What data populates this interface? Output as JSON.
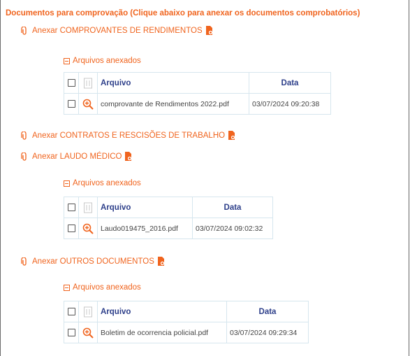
{
  "page_title": "Documentos para comprovação (Clique abaixo para anexar os documentos comprobatórios)",
  "colors": {
    "accent": "#f0641e",
    "header_text": "#2d3f8a",
    "border": "#d6e6ee"
  },
  "sections": [
    {
      "link": "Anexar COMPROVANTES DE RENDIMENTOS",
      "attached_label": "Arquivos anexados",
      "col_file": "Arquivo",
      "col_date": "Data",
      "files": [
        {
          "name": "comprovante de Rendimentos 2022.pdf",
          "date": "03/07/2024 09:20:38"
        }
      ]
    },
    {
      "link": "Anexar CONTRATOS E RESCISÕES DE TRABALHO"
    },
    {
      "link": "Anexar LAUDO MÉDICO",
      "attached_label": "Arquivos anexados",
      "col_file": "Arquivo",
      "col_date": "Data",
      "files": [
        {
          "name": "Laudo019475_2016.pdf",
          "date": "03/07/2024 09:02:32"
        }
      ]
    },
    {
      "link": "Anexar OUTROS DOCUMENTOS",
      "attached_label": "Arquivos anexados",
      "col_file": "Arquivo",
      "col_date": "Data",
      "files": [
        {
          "name": "Boletim de ocorrencia policial.pdf",
          "date": "03/07/2024 09:29:34"
        }
      ]
    }
  ]
}
